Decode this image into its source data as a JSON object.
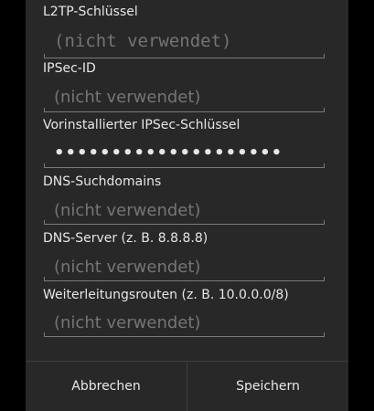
{
  "fields": [
    {
      "label": "L2TP-Schlüssel",
      "value": "",
      "placeholder": "(nicht verwendet)"
    },
    {
      "label": "IPSec-ID",
      "value": "",
      "placeholder": "(nicht verwendet)"
    },
    {
      "label": "Vorinstallierter IPSec-Schlüssel",
      "value": "••••••••••••••••••••",
      "placeholder": ""
    },
    {
      "label": "DNS-Suchdomains",
      "value": "",
      "placeholder": "(nicht verwendet)"
    },
    {
      "label": "DNS-Server (z. B. 8.8.8.8)",
      "value": "",
      "placeholder": "(nicht verwendet)"
    },
    {
      "label": "Weiterleitungsrouten (z. B. 10.0.0.0/8)",
      "value": "",
      "placeholder": "(nicht verwendet)"
    }
  ],
  "buttons": {
    "cancel": "Abbrechen",
    "save": "Speichern"
  },
  "colors": {
    "dialog_background": "#282828",
    "outside_background": "#000000",
    "text": "#e6e6e6",
    "hint": "#8a8a8a",
    "underline": "#7a7a7a"
  }
}
